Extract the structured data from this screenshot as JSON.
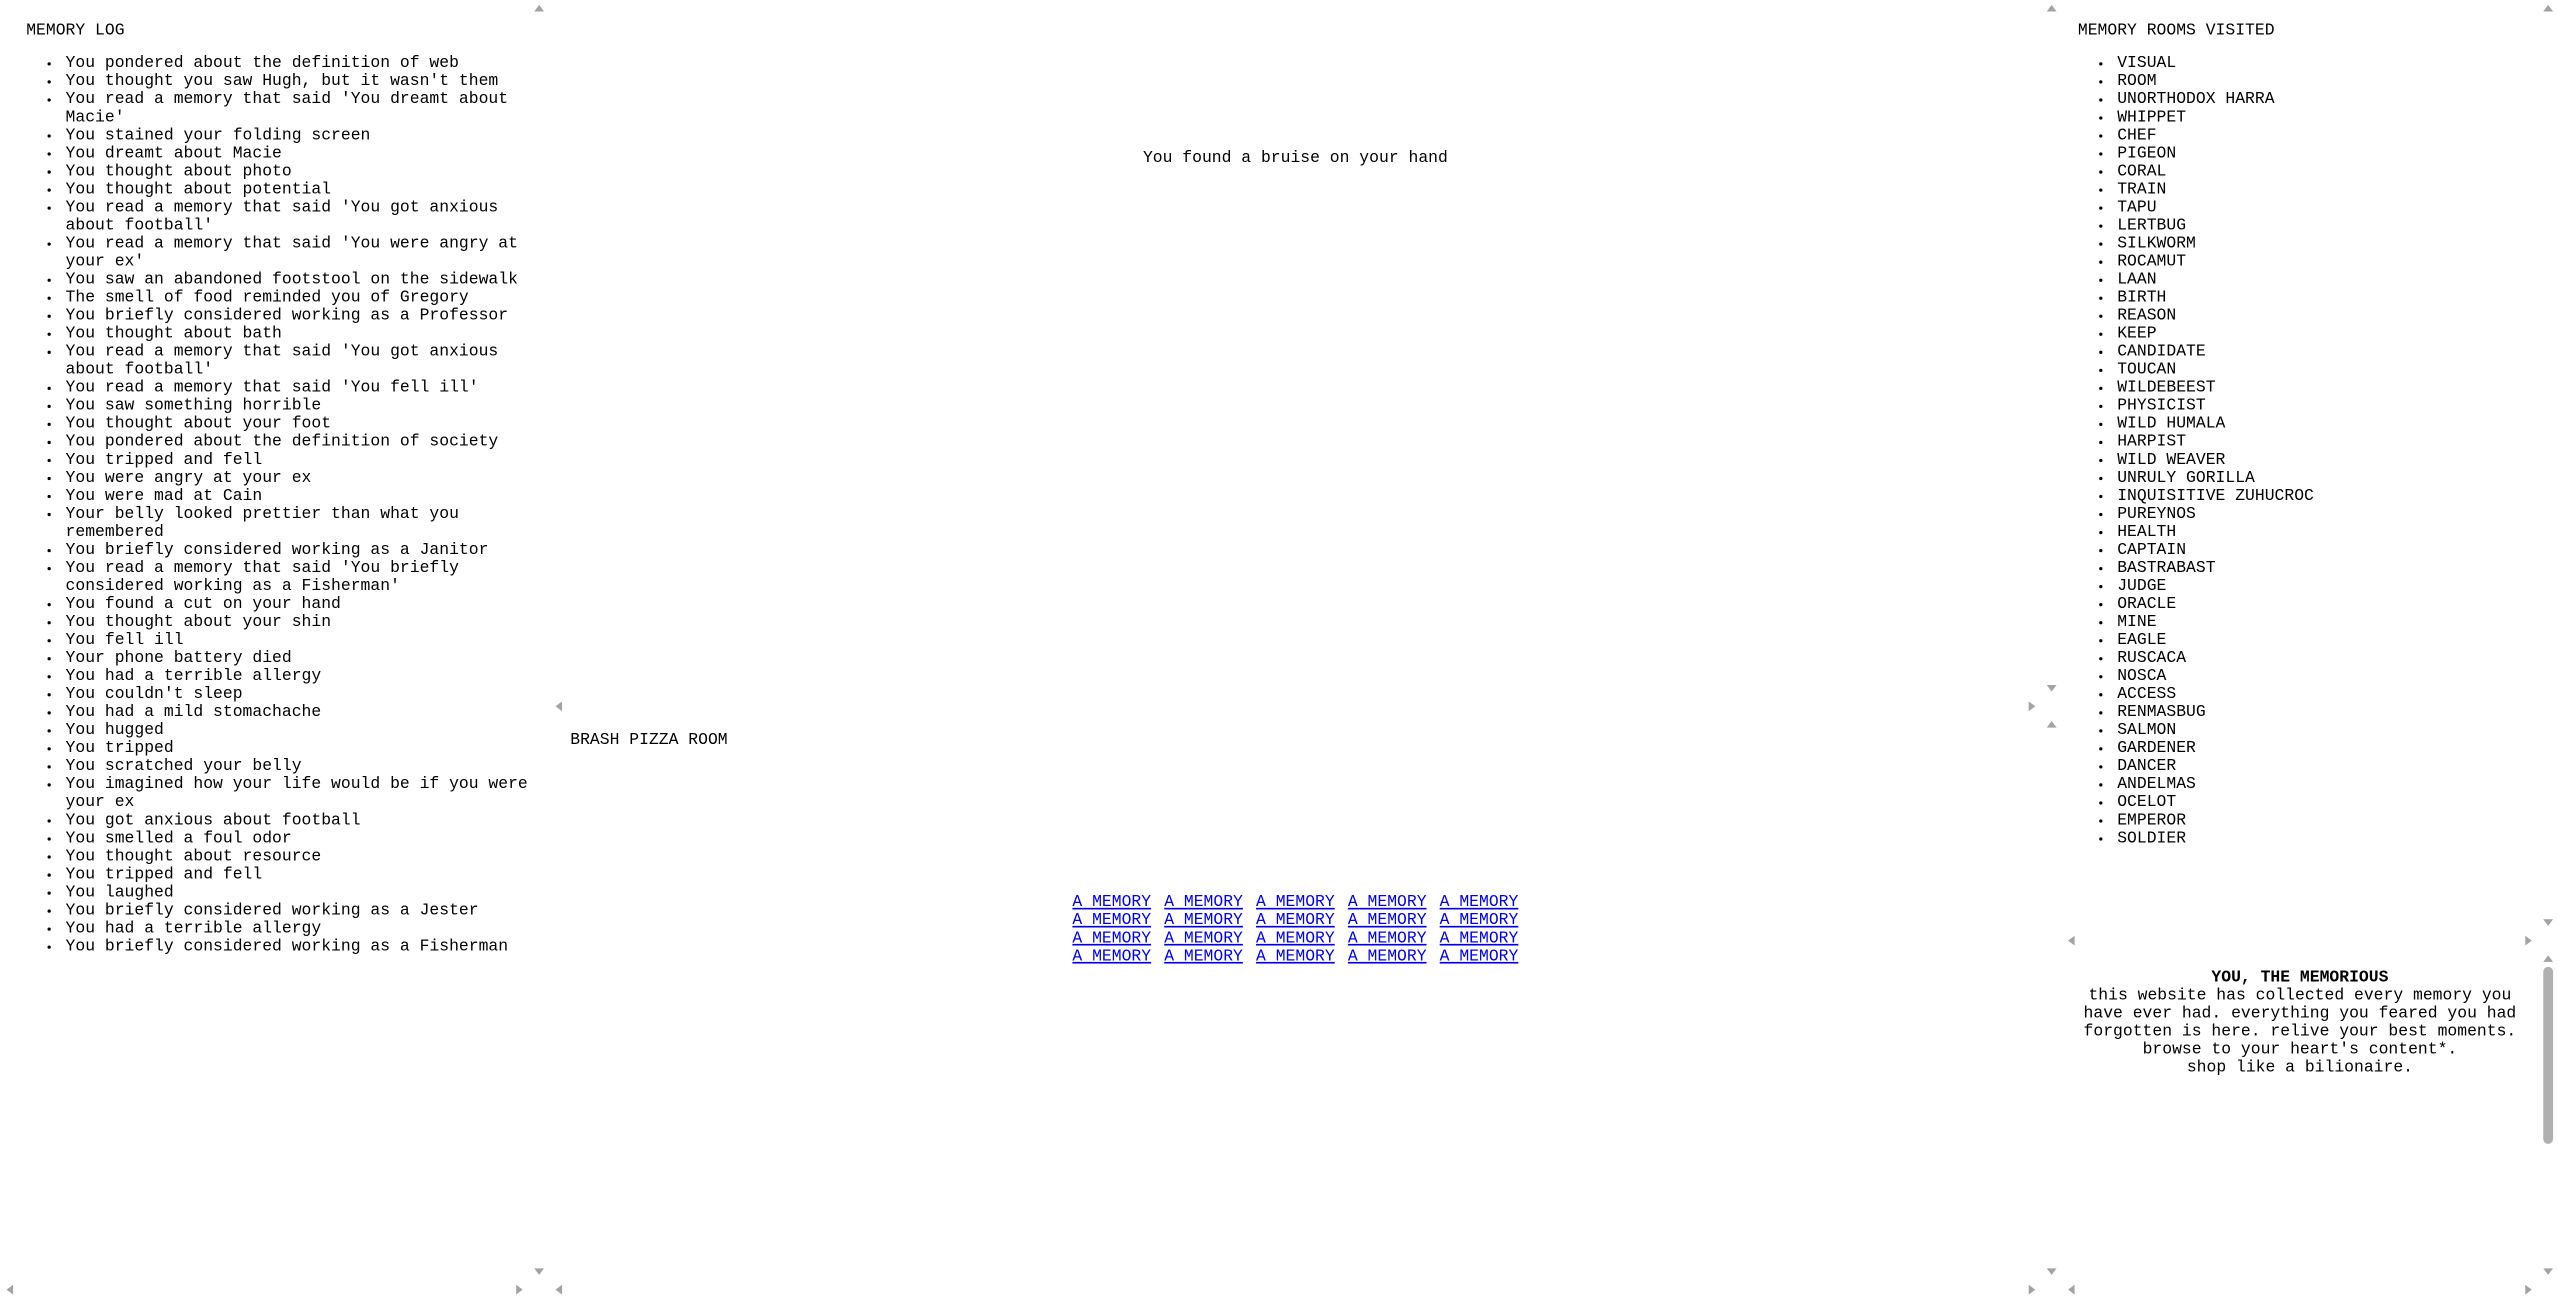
{
  "memory_log": {
    "title": "MEMORY LOG",
    "items": [
      "You pondered about the definition of web",
      "You thought you saw Hugh, but it wasn't them",
      "You read a memory that said 'You dreamt about Macie'",
      "You stained your folding screen",
      "You dreamt about Macie",
      "You thought about photo",
      "You thought about potential",
      "You read a memory that said 'You got anxious about football'",
      "You read a memory that said 'You were angry at your ex'",
      "You saw an abandoned footstool on the sidewalk",
      "The smell of food reminded you of Gregory",
      "You briefly considered working as a Professor",
      "You thought about bath",
      "You read a memory that said 'You got anxious about football'",
      "You read a memory that said 'You fell ill'",
      "You saw something horrible",
      "You thought about your foot",
      "You pondered about the definition of society",
      "You tripped and fell",
      "You were angry at your ex",
      "You were mad at Cain",
      "Your belly looked prettier than what you remembered",
      "You briefly considered working as a Janitor",
      "You read a memory that said 'You briefly considered working as a Fisherman'",
      "You found a cut on your hand",
      "You thought about your shin",
      "You fell ill",
      "Your phone battery died",
      "You had a terrible allergy",
      "You couldn't sleep",
      "You had a mild stomachache",
      "You hugged",
      "You tripped",
      "You scratched your belly",
      "You imagined how your life would be if you were your ex",
      "You got anxious about football",
      "You smelled a foul odor",
      "You thought about resource",
      "You tripped and fell",
      "You laughed",
      "You briefly considered working as a Jester",
      "You had a terrible allergy",
      "You briefly considered working as a Fisherman"
    ]
  },
  "center_top": {
    "text": "You found a bruise on your hand"
  },
  "room": {
    "title": "BRASH PIZZA ROOM",
    "link_label": "A MEMORY",
    "link_rows": [
      [
        "A MEMORY",
        "A MEMORY",
        "A MEMORY",
        "A MEMORY",
        "A MEMORY"
      ],
      [
        "A MEMORY",
        "A MEMORY",
        "A MEMORY",
        "A MEMORY",
        "A MEMORY"
      ],
      [
        "A MEMORY",
        "A MEMORY",
        "A MEMORY",
        "A MEMORY",
        "A MEMORY"
      ],
      [
        "A MEMORY",
        "A MEMORY",
        "A MEMORY",
        "A MEMORY",
        "A MEMORY"
      ]
    ]
  },
  "rooms_visited": {
    "title": "MEMORY ROOMS VISITED",
    "items": [
      "VISUAL",
      "ROOM",
      "UNORTHODOX HARRA",
      "WHIPPET",
      "CHEF",
      "PIGEON",
      "CORAL",
      "TRAIN",
      "TAPU",
      "LERTBUG",
      "SILKWORM",
      "ROCAMUT",
      "LAAN",
      "BIRTH",
      "REASON",
      "KEEP",
      "CANDIDATE",
      "TOUCAN",
      "WILDEBEEST",
      "PHYSICIST",
      "WILD HUMALA",
      "HARPIST",
      "WILD WEAVER",
      "UNRULY GORILLA",
      "INQUISITIVE ZUHUCROC",
      "PUREYNOS",
      "HEALTH",
      "CAPTAIN",
      "BASTRABAST",
      "JUDGE",
      "ORACLE",
      "MINE",
      "EAGLE",
      "RUSCACA",
      "NOSCA",
      "ACCESS",
      "RENMASBUG",
      "SALMON",
      "GARDENER",
      "DANCER",
      "ANDELMAS",
      "OCELOT",
      "EMPEROR",
      "SOLDIER"
    ]
  },
  "about": {
    "title": "YOU, THE MEMORIOUS",
    "lines": [
      "this website has collected every memory you",
      "have ever had. everything you feared you had",
      "forgotten is here. relive your best moments.",
      "browse to your heart's content*.",
      "shop like a bilionaire."
    ]
  },
  "colors": {
    "link": "#0000ee",
    "scroll_arrow": "#a3a3a3",
    "background": "#ffffff"
  }
}
